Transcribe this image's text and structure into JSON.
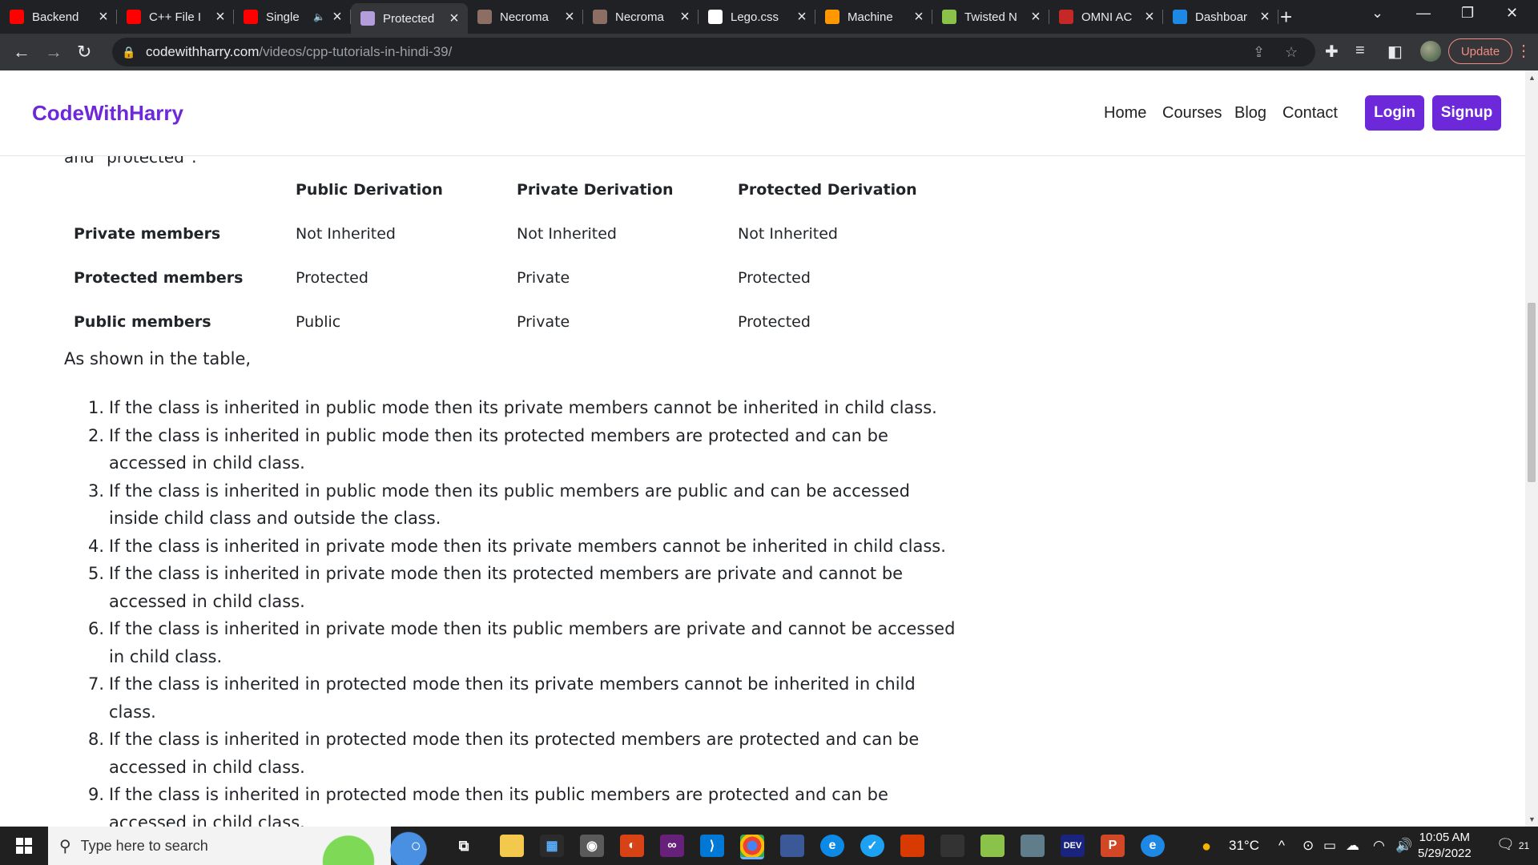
{
  "browser": {
    "tabs": [
      {
        "title": "Backend",
        "favicon": "youtube-icon",
        "color": "#ff0000"
      },
      {
        "title": "C++ File I",
        "favicon": "youtube-icon",
        "color": "#ff0000"
      },
      {
        "title": "Single",
        "favicon": "youtube-icon",
        "color": "#ff0000",
        "audio": "speaker-icon"
      },
      {
        "title": "Protected",
        "favicon": "codewithharry-avatar-icon",
        "color": "#b39ddb",
        "active": true
      },
      {
        "title": "Necroma",
        "favicon": "necromancer-book-icon",
        "color": "#8d6e63"
      },
      {
        "title": "Necroma",
        "favicon": "necromancer-book-icon",
        "color": "#8d6e63"
      },
      {
        "title": "Lego.css",
        "favicon": "lego-icon",
        "color": "#ffffff"
      },
      {
        "title": "Machine",
        "favicon": "tensorflow-icon",
        "color": "#ff9800"
      },
      {
        "title": "Twisted N",
        "favicon": "twisted-icon",
        "color": "#8bc34a"
      },
      {
        "title": "OMNI AC",
        "favicon": "omni-icon",
        "color": "#c62828"
      },
      {
        "title": "Dashboar",
        "favicon": "dashboard-icon",
        "color": "#1e88e5"
      }
    ],
    "url_host": "codewithharry.com",
    "url_path": "/videos/cpp-tutorials-in-hindi-39/",
    "update_label": "Update"
  },
  "site": {
    "brand": "CodeWithHarry",
    "nav": [
      "Home",
      "Courses",
      "Blog",
      "Contact"
    ],
    "login_label": "Login",
    "signup_label": "Signup",
    "brand_color": "#6d28d9"
  },
  "article": {
    "cut_text": "and \"protected\".",
    "table": {
      "headers": [
        "",
        "Public Derivation",
        "Private Derivation",
        "Protected Derivation"
      ],
      "rows": [
        [
          "Private members",
          "Not Inherited",
          "Not Inherited",
          "Not Inherited"
        ],
        [
          "Protected members",
          "Protected",
          "Private",
          "Protected"
        ],
        [
          "Public members",
          "Public",
          "Private",
          "Protected"
        ]
      ]
    },
    "lead": "As shown in the table,",
    "points": [
      "If the class is inherited in public mode then its private members cannot be inherited in child class.",
      "If the class is inherited in public mode then its protected members are protected and can be accessed in child class.",
      "If the class is inherited in public mode then its public members are public and can be accessed inside child class and outside the class.",
      "If the class is inherited in private mode then its private members cannot be inherited in child class.",
      "If the class is inherited in private mode then its protected members are private and cannot be accessed in child class.",
      "If the class is inherited in private mode then its public members are private and cannot be accessed in child class.",
      "If the class is inherited in protected mode then its private members cannot be inherited in child class.",
      "If the class is inherited in protected mode then its protected members are protected and can be accessed in child class.",
      "If the class is inherited in protected mode then its public members are protected and can be accessed in child class."
    ]
  },
  "taskbar": {
    "search_placeholder": "Type here to search",
    "weather": "31°C",
    "time": "10:05 AM",
    "date": "5/29/2022",
    "notifications": "21"
  }
}
